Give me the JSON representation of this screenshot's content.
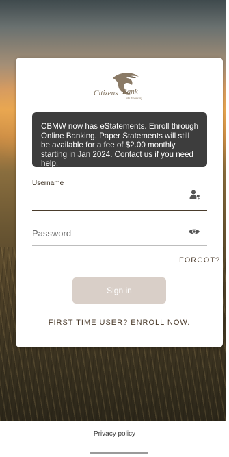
{
  "brand": {
    "logo_word1": "Citizens",
    "logo_word2": "Bank",
    "logo_tagline": "Be Yourself"
  },
  "notice": {
    "text": "CBMW now has eStatements. Enroll through Online Banking. Paper Statements will still be available for a fee of $2.00 monthly starting in Jan 2024. Contact us if you need help."
  },
  "login": {
    "username_label": "Username",
    "username_value": "",
    "password_placeholder": "Password",
    "forgot_label": "FORGOT?",
    "signin_label": "Sign in",
    "enroll_label": "FIRST TIME USER? ENROLL NOW."
  },
  "footer": {
    "privacy_label": "Privacy policy"
  },
  "colors": {
    "accent": "#4a3c2c",
    "signin_disabled": "#d9cfc8",
    "notice_bg": "#3d3d3d"
  },
  "icons": {
    "username": "person-key-icon",
    "password": "eye-icon"
  }
}
